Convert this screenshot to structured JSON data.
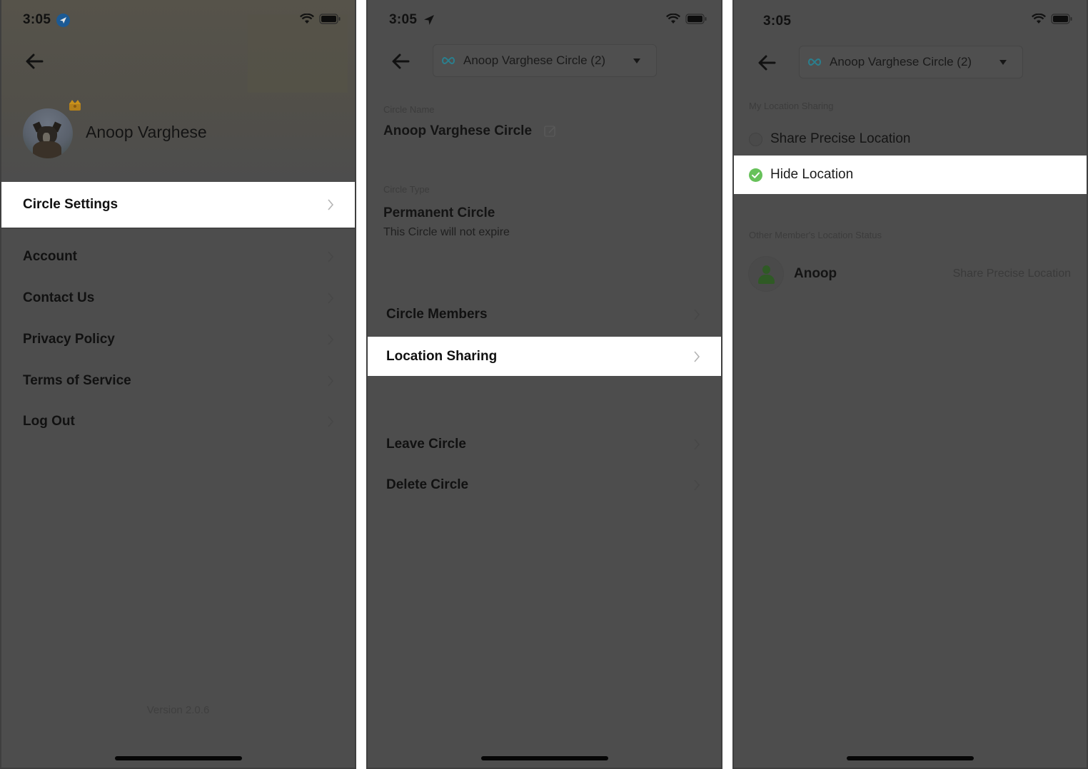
{
  "colors": {
    "overlay_bg": "#4d4d4d",
    "highlight_bg": "#ffffff",
    "location_badge": "#1c5a94",
    "crown": "#c9911a",
    "selected_radio": "#67c15a",
    "infinity_icon": "#2a9fb0"
  },
  "screens": [
    {
      "status_bar": {
        "time": "3:05",
        "location_icon": "location-badge-icon",
        "wifi_icon": "wifi-icon",
        "battery_icon": "battery-icon"
      },
      "back_icon": "back-arrow-icon",
      "profile": {
        "name": "Anoop Varghese",
        "avatar_icon": "dog-avatar",
        "badge_icon": "crown-icon"
      },
      "menu": [
        {
          "label": "Circle Settings",
          "highlighted": true
        },
        {
          "label": "Account",
          "highlighted": false
        },
        {
          "label": "Contact Us",
          "highlighted": false
        },
        {
          "label": "Privacy Policy",
          "highlighted": false
        },
        {
          "label": "Terms of Service",
          "highlighted": false
        },
        {
          "label": "Log Out",
          "highlighted": false
        }
      ],
      "version": "Version 2.0.6"
    },
    {
      "status_bar": {
        "time": "3:05",
        "location_icon": "location-arrow-icon",
        "wifi_icon": "wifi-icon",
        "battery_icon": "battery-icon"
      },
      "back_icon": "back-arrow-icon",
      "circle_selector": {
        "label": "Anoop Varghese Circle (2)",
        "icon": "infinity-icon",
        "caret": "caret-down-icon"
      },
      "circle_name": {
        "caption": "Circle Name",
        "value": "Anoop Varghese Circle",
        "edit_icon": "edit-icon"
      },
      "circle_type": {
        "caption": "Circle Type",
        "value": "Permanent Circle",
        "note": "This Circle will not expire"
      },
      "menu": [
        {
          "label": "Circle Members",
          "highlighted": false
        },
        {
          "label": "Location Sharing",
          "highlighted": true
        },
        {
          "label": "Leave Circle",
          "highlighted": false
        },
        {
          "label": "Delete Circle",
          "highlighted": false
        }
      ]
    },
    {
      "status_bar": {
        "time": "3:05",
        "wifi_icon": "wifi-icon",
        "battery_icon": "battery-icon"
      },
      "back_icon": "back-arrow-icon",
      "circle_selector": {
        "label": "Anoop Varghese Circle (2)",
        "icon": "infinity-icon",
        "caret": "caret-down-icon"
      },
      "my_location": {
        "caption": "My Location Sharing",
        "options": [
          {
            "label": "Share Precise Location",
            "selected": false
          },
          {
            "label": "Hide Location",
            "selected": true
          }
        ]
      },
      "others": {
        "caption": "Other Member's Location Status",
        "members": [
          {
            "name": "Anoop",
            "status": "Share Precise Location"
          }
        ]
      }
    }
  ]
}
